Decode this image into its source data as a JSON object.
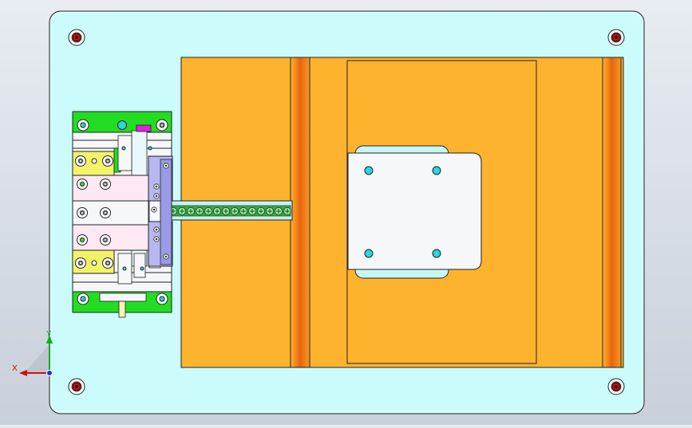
{
  "viewport": {
    "background_top": "#e8ecf2",
    "background_bottom": "#c9d0db"
  },
  "colors": {
    "base_plate": "#ccfbfb",
    "orange_block": "#fdb32e",
    "orange_rail": "#f07a12",
    "white_plate": "#f5f7f8",
    "green_plate": "#22dd22",
    "yellow_block": "#f3f36a",
    "pink_block": "#fde8f3",
    "purple_block": "#b8b8f0",
    "magenta_tab": "#e020e0",
    "cyan_hole": "#2ad6e0",
    "red_screw": "#cc1111",
    "outline": "#222222"
  },
  "model": {
    "screw_count": 4,
    "conveyor_part_count": 15,
    "top_plate_hole_count": 4
  },
  "triad": {
    "x_label": "X",
    "y_label": "Y",
    "x_icon": "x-axis-arrow-icon",
    "y_icon": "y-axis-arrow-icon",
    "z_icon": "z-axis-dot-icon"
  }
}
